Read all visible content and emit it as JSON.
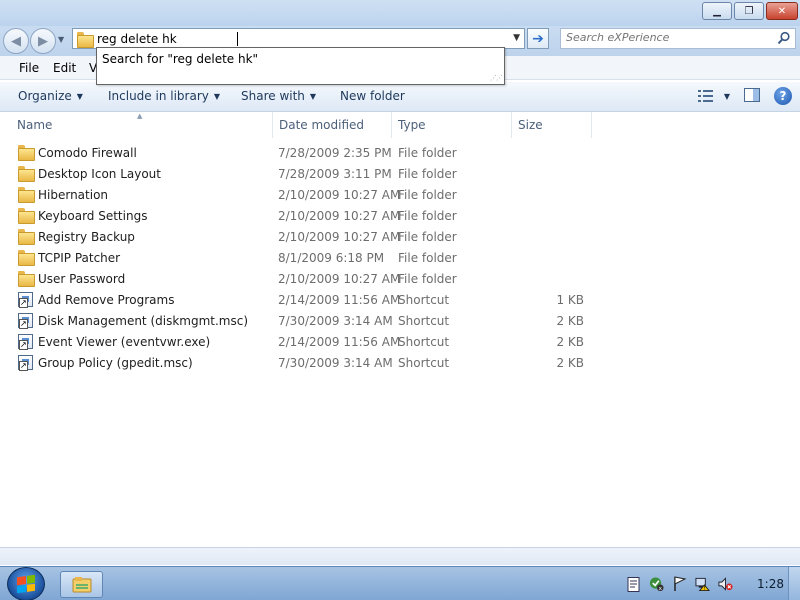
{
  "window": {
    "controls": {
      "minimize_icon": "minimize-icon",
      "restore_icon": "restore-icon",
      "close_icon": "close-icon"
    }
  },
  "navigation": {
    "back_icon": "back-arrow-icon",
    "forward_icon": "forward-arrow-icon",
    "address_value": "reg delete hk",
    "go_icon": "go-arrow-icon",
    "search_placeholder": "Search eXPerience"
  },
  "autocomplete": {
    "suggestion": "Search for \"reg delete hk\""
  },
  "menu": {
    "file": "File",
    "edit": "Edit",
    "view_partial": "V"
  },
  "toolbar": {
    "organize": "Organize",
    "include_in_library": "Include in library",
    "share_with": "Share with",
    "new_folder": "New folder",
    "help": "?"
  },
  "columns": {
    "name": "Name",
    "date_modified": "Date modified",
    "type": "Type",
    "size": "Size"
  },
  "files": [
    {
      "name": "Comodo Firewall",
      "date": "7/28/2009 2:35 PM",
      "type": "File folder",
      "size": "",
      "icon": "folder"
    },
    {
      "name": "Desktop Icon Layout",
      "date": "7/28/2009 3:11 PM",
      "type": "File folder",
      "size": "",
      "icon": "folder"
    },
    {
      "name": "Hibernation",
      "date": "2/10/2009 10:27 AM",
      "type": "File folder",
      "size": "",
      "icon": "folder"
    },
    {
      "name": "Keyboard Settings",
      "date": "2/10/2009 10:27 AM",
      "type": "File folder",
      "size": "",
      "icon": "folder"
    },
    {
      "name": "Registry Backup",
      "date": "2/10/2009 10:27 AM",
      "type": "File folder",
      "size": "",
      "icon": "folder"
    },
    {
      "name": "TCPIP Patcher",
      "date": "8/1/2009 6:18 PM",
      "type": "File folder",
      "size": "",
      "icon": "folder"
    },
    {
      "name": "User Password",
      "date": "2/10/2009 10:27 AM",
      "type": "File folder",
      "size": "",
      "icon": "folder"
    },
    {
      "name": "Add Remove Programs",
      "date": "2/14/2009 11:56 AM",
      "type": "Shortcut",
      "size": "1 KB",
      "icon": "shortcut"
    },
    {
      "name": "Disk Management (diskmgmt.msc)",
      "date": "7/30/2009 3:14 AM",
      "type": "Shortcut",
      "size": "2 KB",
      "icon": "shortcut"
    },
    {
      "name": "Event Viewer (eventvwr.exe)",
      "date": "2/14/2009 11:56 AM",
      "type": "Shortcut",
      "size": "2 KB",
      "icon": "shortcut"
    },
    {
      "name": "Group Policy (gpedit.msc)",
      "date": "7/30/2009 3:14 AM",
      "type": "Shortcut",
      "size": "2 KB",
      "icon": "shortcut"
    }
  ],
  "taskbar": {
    "start_icon": "windows-start-icon",
    "explorer_icon": "explorer-folder-icon",
    "tray_icons": [
      "document-icon",
      "security-shield-icon",
      "flag-icon",
      "network-icon",
      "volume-muted-icon"
    ],
    "clock": "1:28"
  }
}
